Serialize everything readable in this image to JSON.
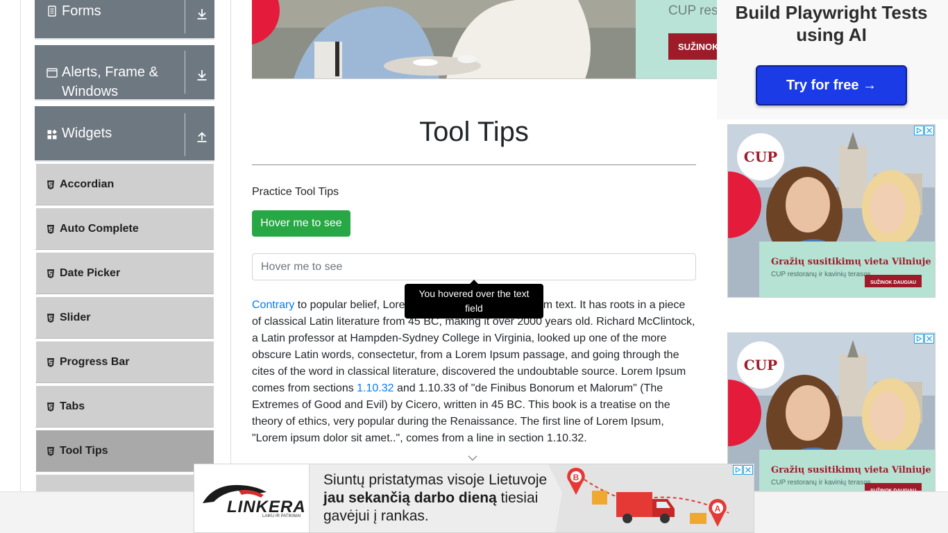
{
  "sidebar": {
    "groups": [
      {
        "label": "Forms",
        "arrow": "download-icon"
      },
      {
        "label": "Alerts, Frame & Windows",
        "arrow": "download-icon"
      },
      {
        "label": "Widgets",
        "arrow": "upload-icon"
      }
    ],
    "items": [
      {
        "label": "Accordian"
      },
      {
        "label": "Auto Complete"
      },
      {
        "label": "Date Picker"
      },
      {
        "label": "Slider"
      },
      {
        "label": "Progress Bar"
      },
      {
        "label": "Tabs"
      },
      {
        "label": "Tool Tips",
        "active": true
      }
    ]
  },
  "main": {
    "top_banner_text": "CUP res",
    "top_banner_button": "SUŽINOK",
    "title": "Tool Tips",
    "practice_label": "Practice Tool Tips",
    "hover_button": "Hover me to see",
    "hover_input_placeholder": "Hover me to see",
    "tooltip_text": "You hovered over the text field",
    "article": {
      "link1": "Contrary",
      "part1": " to popular belief, Lorem Ipsum is not simply random text. It has roots in a piece of classical Latin literature from 45 BC, making it over 2000 years old. Richard McClintock, a Latin professor at Hampden-Sydney College in Virginia, looked up one of the more obscure Latin words, consectetur, from a Lorem Ipsum passage, and going through the cites of the word in classical literature, discovered the undoubtable source. Lorem Ipsum comes from sections ",
      "link2": "1.10.32",
      "part2": " and 1.10.33 of \"de Finibus Bonorum et Malorum\" (The Extremes of Good and Evil) by Cicero, written in 45 BC. This book is a treatise on the theory of ethics, very popular during the Renaissance. The first line of Lorem Ipsum, \"Lorem ipsum dolor sit amet..\", comes from a line in section 1.10.32."
    }
  },
  "right_ads": {
    "playwright_title": "Build Playwright Tests using AI",
    "playwright_button": "Try for free →",
    "cup_ad": {
      "logo": "CUP",
      "headline": "Gražių susitikimų vieta Vilniuje",
      "sub": "CUP restoranų ir kavinių terasos",
      "button": "SUŽINOK DAUGIAU"
    }
  },
  "bottom_ad": {
    "brand": "LINKERA",
    "tagline": "LAIKU IR PATIKIMAI",
    "text_plain1": "Siuntų pristatymas visoje Lietuvoje ",
    "text_bold": "jau sekančią darbo dieną",
    "text_plain2": " tiesiai gavėjui į rankas.",
    "pin_b": "B",
    "pin_a": "A"
  },
  "colors": {
    "group_header_bg": "#6e7881",
    "menu_item_bg": "#cfcfcf",
    "menu_item_active_bg": "#a9a9a9",
    "success_green": "#28a745",
    "link_blue": "#007bff",
    "cup_red": "#9e1b2a"
  }
}
